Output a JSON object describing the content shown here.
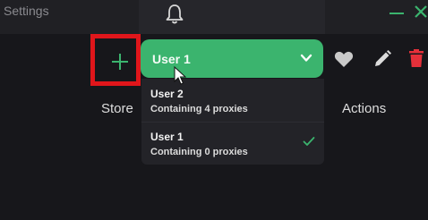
{
  "window": {
    "title": "Settings",
    "controls": {
      "minimize": "minimize-icon",
      "close": "close-icon"
    }
  },
  "toolbar": {
    "bell_icon": "bell-icon",
    "add_icon": "plus-icon",
    "add_highlight_color": "#e0161b",
    "accent_color": "#3bb46e"
  },
  "user_select": {
    "selected": "User 1",
    "chevron_icon": "chevron-down-icon",
    "options": [
      {
        "name": "User 2",
        "subtitle": "Containing 4 proxies",
        "selected": false
      },
      {
        "name": "User 1",
        "subtitle": "Containing 0 proxies",
        "selected": true
      }
    ]
  },
  "table": {
    "headers": {
      "store": "Store",
      "actions": "Actions"
    }
  },
  "actions": {
    "favorite_icon": "heart-icon",
    "edit_icon": "pencil-icon",
    "delete_icon": "trash-icon",
    "delete_color": "#e5303a"
  }
}
